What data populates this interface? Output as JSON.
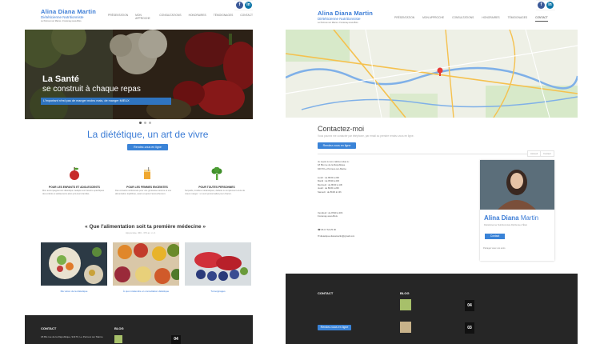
{
  "brand": {
    "name": "Alina Diana Martin",
    "subtitle": "Diététicienne Nutritionniste",
    "tagline": "Le Perreux sur Marne • Fontenay-sous-Bois",
    "accent": "#3a7bd5",
    "footer_bg": "#262626"
  },
  "nav": [
    "Présentation",
    "Mon approche",
    "Consultations",
    "Honoraires",
    "Témoignages",
    "Contact"
  ],
  "social": [
    {
      "icon": "facebook-icon",
      "glyph": "f"
    },
    {
      "icon": "linkedin-icon",
      "glyph": "in"
    }
  ],
  "home": {
    "hero": {
      "title_line1": "La Santé",
      "title_line2": "se construit à chaque repas",
      "caption": "L'important n'est pas de manger moins mais, de manger MIEUX"
    },
    "section_title": "La diététique, un art de vivre",
    "cta_label": "Rendez-vous en ligne",
    "features": [
      {
        "icon": "apple-icon",
        "title": "Pour les enfants et adolescents",
        "text": "Mon accompagnement diététique s'adapte aux besoins spécifiques des enfants et adolescents ainsi qu'à leurs familles."
      },
      {
        "icon": "juice-icon",
        "title": "Pour les femmes enceintes",
        "text": "Des conseils nutritionnels pour une grossesse sereine et une alimentation équilibrée, avant et après l'accouchement."
      },
      {
        "icon": "broccoli-icon",
        "title": "Pour toutes personnes",
        "text": "Surpoids, troubles métaboliques, diabète ou simplement envie de mieux manger : un suivi personnalisé pour chacun."
      }
    ],
    "quote": "« Que l'alimentation soit ta première médecine »",
    "quote_author": "Hippocrate, 460 - 370 av. J.-C.",
    "cards": [
      {
        "caption": "Ma vision de la diététique"
      },
      {
        "caption": "À quoi s'attendre en consultation diététique"
      },
      {
        "caption": "Témoignages"
      }
    ],
    "footer": {
      "contact_heading": "CONTACT",
      "blog_heading": "BLOG",
      "address": "18 Bis rue de la République, 94170, Le Perreux sur Marne",
      "blog_date": "04"
    }
  },
  "contact": {
    "title": "Contactez-moi",
    "subtitle": "Vous pouvez me contacter par téléphone, par email ou prendre rendez-vous en ligne.",
    "cta_label": "Rendez-vous en ligne",
    "breadcrumb": [
      "Accueil",
      "Contact"
    ],
    "address_lines": [
      "Je reçois à mon cabinet situé à :",
      "18 Bis rue de la République",
      "94170 Le Perreux-sur-Marne"
    ],
    "hours": [
      "Lundi : de 8h30 à 20h",
      "Mardi : de 8h30 à 20h",
      "Mercredi : de 8h30 à 13h",
      "Jeudi : de 8h30 à 20h",
      "Samedi : de 8h30 à 13h"
    ],
    "second_office": [
      "Vendredi : de 8h30 à 20h",
      "Fontenay-sous-Bois"
    ],
    "phone": "06 17 64 25 00",
    "email": "dietetique.dianamartin@gmail.com",
    "profile": {
      "first": "Alina Diana",
      "last": "Martin",
      "role": "Diététicienne Nutritionniste Diplômée d'État",
      "button": "Contact",
      "follow": "Partagez avec vos amis"
    },
    "footer": {
      "contact_heading": "CONTACT",
      "blog_heading": "BLOG",
      "cta_label": "Rendez-vous en ligne",
      "dates": [
        "04",
        "03"
      ]
    }
  }
}
